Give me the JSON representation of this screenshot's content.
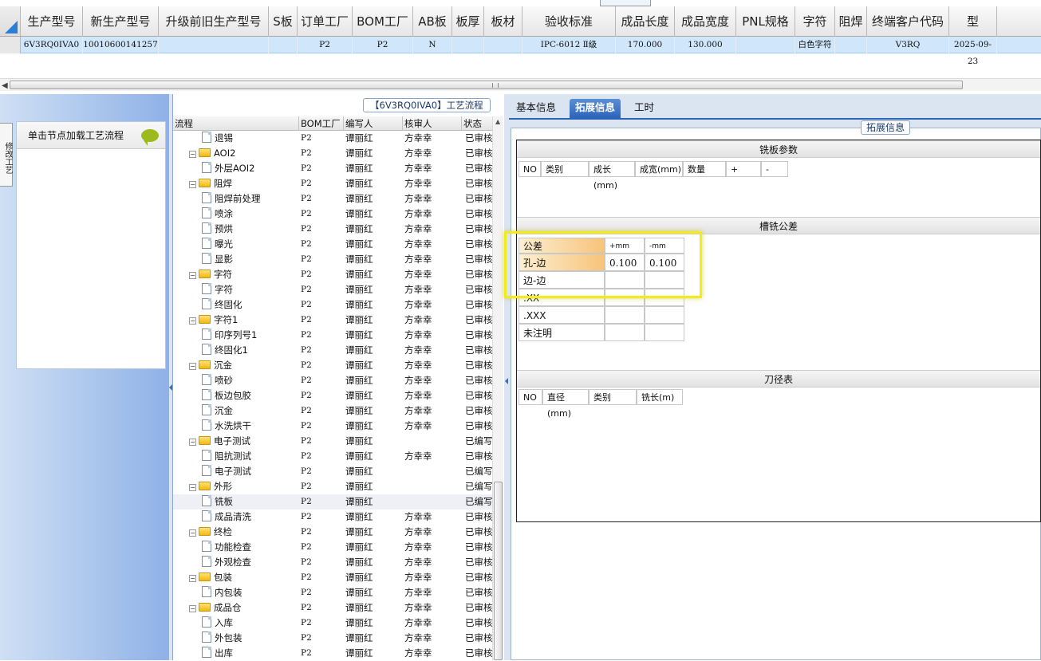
{
  "grid": {
    "columns": [
      "生产型号",
      "新生产型号",
      "升级前旧生产型号",
      "S板",
      "订单工厂",
      "BOM工厂",
      "AB板",
      "板厚",
      "板材",
      "验收标准",
      "成品长度",
      "成品宽度",
      "PNL规格",
      "字符",
      "阻焊",
      "终端客户代码",
      "型"
    ],
    "row": [
      "6V3RQ0IVA0",
      "10010600141257",
      "",
      "",
      "P2",
      "P2",
      "N",
      "",
      "",
      "IPC-6012 Ⅱ级",
      "170.000",
      "130.000",
      "",
      "白色字符",
      "",
      "V3RQ",
      "2025-09-23"
    ]
  },
  "left": {
    "side_tab": "修改工艺",
    "node_hint": "单击节点加载工艺流程"
  },
  "process": {
    "title": "【6V3RQ0IVA0】工艺流程",
    "headers": [
      "流程",
      "BOM工厂",
      "编写人",
      "核审人",
      "状态"
    ],
    "rows": [
      {
        "name": "退锡",
        "level": 2,
        "bom": "P2",
        "writer": "谭丽红",
        "reviewer": "方幸幸",
        "status": "已审核"
      },
      {
        "name": "AOI2",
        "level": 1,
        "bom": "P2",
        "writer": "谭丽红",
        "reviewer": "方幸幸",
        "status": "已审核"
      },
      {
        "name": "外层AOI2",
        "level": 2,
        "bom": "P2",
        "writer": "谭丽红",
        "reviewer": "方幸幸",
        "status": "已审核"
      },
      {
        "name": "阻焊",
        "level": 1,
        "bom": "P2",
        "writer": "谭丽红",
        "reviewer": "方幸幸",
        "status": "已审核"
      },
      {
        "name": "阻焊前处理",
        "level": 2,
        "bom": "P2",
        "writer": "谭丽红",
        "reviewer": "方幸幸",
        "status": "已审核"
      },
      {
        "name": "喷涂",
        "level": 2,
        "bom": "P2",
        "writer": "谭丽红",
        "reviewer": "方幸幸",
        "status": "已审核"
      },
      {
        "name": "预烘",
        "level": 2,
        "bom": "P2",
        "writer": "谭丽红",
        "reviewer": "方幸幸",
        "status": "已审核"
      },
      {
        "name": "曝光",
        "level": 2,
        "bom": "P2",
        "writer": "谭丽红",
        "reviewer": "方幸幸",
        "status": "已审核"
      },
      {
        "name": "显影",
        "level": 2,
        "bom": "P2",
        "writer": "谭丽红",
        "reviewer": "方幸幸",
        "status": "已审核"
      },
      {
        "name": "字符",
        "level": 1,
        "bom": "P2",
        "writer": "谭丽红",
        "reviewer": "方幸幸",
        "status": "已审核"
      },
      {
        "name": "字符",
        "level": 2,
        "bom": "P2",
        "writer": "谭丽红",
        "reviewer": "方幸幸",
        "status": "已审核"
      },
      {
        "name": "终固化",
        "level": 2,
        "bom": "P2",
        "writer": "谭丽红",
        "reviewer": "方幸幸",
        "status": "已审核"
      },
      {
        "name": "字符1",
        "level": 1,
        "bom": "P2",
        "writer": "谭丽红",
        "reviewer": "方幸幸",
        "status": "已审核"
      },
      {
        "name": "印序列号1",
        "level": 2,
        "bom": "P2",
        "writer": "谭丽红",
        "reviewer": "方幸幸",
        "status": "已审核"
      },
      {
        "name": "终固化1",
        "level": 2,
        "bom": "P2",
        "writer": "谭丽红",
        "reviewer": "方幸幸",
        "status": "已审核"
      },
      {
        "name": "沉金",
        "level": 1,
        "bom": "P2",
        "writer": "谭丽红",
        "reviewer": "方幸幸",
        "status": "已审核"
      },
      {
        "name": "喷砂",
        "level": 2,
        "bom": "P2",
        "writer": "谭丽红",
        "reviewer": "方幸幸",
        "status": "已审核"
      },
      {
        "name": "板边包胶",
        "level": 2,
        "bom": "P2",
        "writer": "谭丽红",
        "reviewer": "方幸幸",
        "status": "已审核"
      },
      {
        "name": "沉金",
        "level": 2,
        "bom": "P2",
        "writer": "谭丽红",
        "reviewer": "方幸幸",
        "status": "已审核"
      },
      {
        "name": "水洗烘干",
        "level": 2,
        "bom": "P2",
        "writer": "谭丽红",
        "reviewer": "方幸幸",
        "status": "已审核"
      },
      {
        "name": "电子测试",
        "level": 1,
        "bom": "P2",
        "writer": "谭丽红",
        "reviewer": "",
        "status": "已编写"
      },
      {
        "name": "阻抗测试",
        "level": 2,
        "bom": "P2",
        "writer": "谭丽红",
        "reviewer": "方幸幸",
        "status": "已审核"
      },
      {
        "name": "电子测试",
        "level": 2,
        "bom": "P2",
        "writer": "谭丽红",
        "reviewer": "",
        "status": "已编写"
      },
      {
        "name": "外形",
        "level": 1,
        "bom": "P2",
        "writer": "谭丽红",
        "reviewer": "",
        "status": "已编写"
      },
      {
        "name": "铣板",
        "level": 2,
        "bom": "P2",
        "writer": "谭丽红",
        "reviewer": "",
        "status": "已编写",
        "selected": true
      },
      {
        "name": "成品清洗",
        "level": 2,
        "bom": "P2",
        "writer": "谭丽红",
        "reviewer": "方幸幸",
        "status": "已审核"
      },
      {
        "name": "终检",
        "level": 1,
        "bom": "P2",
        "writer": "谭丽红",
        "reviewer": "方幸幸",
        "status": "已审核"
      },
      {
        "name": "功能检查",
        "level": 2,
        "bom": "P2",
        "writer": "谭丽红",
        "reviewer": "方幸幸",
        "status": "已审核"
      },
      {
        "name": "外观检查",
        "level": 2,
        "bom": "P2",
        "writer": "谭丽红",
        "reviewer": "方幸幸",
        "status": "已审核"
      },
      {
        "name": "包装",
        "level": 1,
        "bom": "P2",
        "writer": "谭丽红",
        "reviewer": "方幸幸",
        "status": "已审核"
      },
      {
        "name": "内包装",
        "level": 2,
        "bom": "P2",
        "writer": "谭丽红",
        "reviewer": "方幸幸",
        "status": "已审核"
      },
      {
        "name": "成品仓",
        "level": 1,
        "bom": "P2",
        "writer": "谭丽红",
        "reviewer": "方幸幸",
        "status": "已审核"
      },
      {
        "name": "入库",
        "level": 2,
        "bom": "P2",
        "writer": "谭丽红",
        "reviewer": "方幸幸",
        "status": "已审核"
      },
      {
        "name": "外包装",
        "level": 2,
        "bom": "P2",
        "writer": "谭丽红",
        "reviewer": "方幸幸",
        "status": "已审核"
      },
      {
        "name": "出库",
        "level": 2,
        "bom": "P2",
        "writer": "谭丽红",
        "reviewer": "方幸幸",
        "status": "已审核"
      }
    ]
  },
  "right": {
    "tabs": [
      "基本信息",
      "拓展信息",
      "工时"
    ],
    "active_tab": 1,
    "panel_title": "拓展信息",
    "mill_params": {
      "title": "铣板参数",
      "headers": [
        "NO",
        "类别",
        "成长(mm)",
        "成宽(mm)",
        "数量",
        "+",
        "-"
      ]
    },
    "tolerance": {
      "title": "槽铣公差",
      "headers": [
        "公差",
        "+mm",
        "-mm"
      ],
      "rows": [
        [
          "孔-边",
          "0.100",
          "0.100"
        ],
        [
          "边-边",
          "",
          ""
        ],
        [
          ".XX",
          "",
          ""
        ],
        [
          ".XXX",
          "",
          ""
        ],
        [
          "未注明",
          "",
          ""
        ]
      ]
    },
    "tool_table": {
      "title": "刀径表",
      "headers": [
        "NO",
        "直径(mm)",
        "类别",
        "铣长(m)"
      ]
    }
  }
}
